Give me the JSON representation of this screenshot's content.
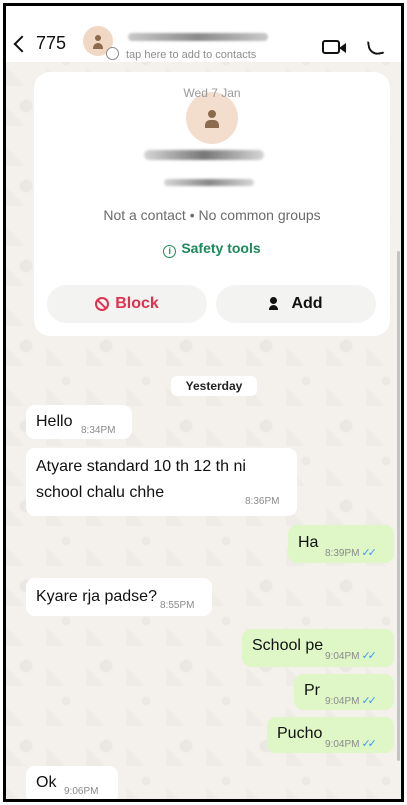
{
  "header": {
    "back_count": "775",
    "contact_hint": "tap here to add to contacts"
  },
  "info_card": {
    "date": "Wed 7 Jan",
    "status": "Not a contact • No common groups",
    "safety_tools": "Safety tools",
    "block_label": "Block",
    "add_label": "Add"
  },
  "day_separator": "Yesterday",
  "messages": [
    {
      "text": "Hello",
      "time": "8:34PM",
      "direction": "in"
    },
    {
      "text": "Atyare standard 10 th 12 th ni school chalu chhe",
      "time": "8:36PM",
      "direction": "in"
    },
    {
      "text": "Ha",
      "time": "8:39PM",
      "direction": "out",
      "read": true
    },
    {
      "text": "Kyare rja padse?",
      "time": "8:55PM",
      "direction": "in"
    },
    {
      "text": "School pe",
      "time": "9:04PM",
      "direction": "out",
      "read": true
    },
    {
      "text": "Pr",
      "time": "9:04PM",
      "direction": "out",
      "read": true
    },
    {
      "text": "Pucho",
      "time": "9:04PM",
      "direction": "out",
      "read": true
    },
    {
      "text": "Ok",
      "time": "9:06PM",
      "direction": "in"
    }
  ],
  "colors": {
    "outgoing_bubble": "#dff6c7",
    "incoming_bubble": "#ffffff",
    "safety_green": "#1b8a5a",
    "block_red": "#e0314f",
    "read_tick_blue": "#3d9bf0"
  },
  "icons": [
    "back-chevron-icon",
    "contact-avatar-icon",
    "video-call-icon",
    "phone-icon",
    "info-circle-icon",
    "block-icon",
    "add-contact-icon",
    "double-check-icon"
  ]
}
